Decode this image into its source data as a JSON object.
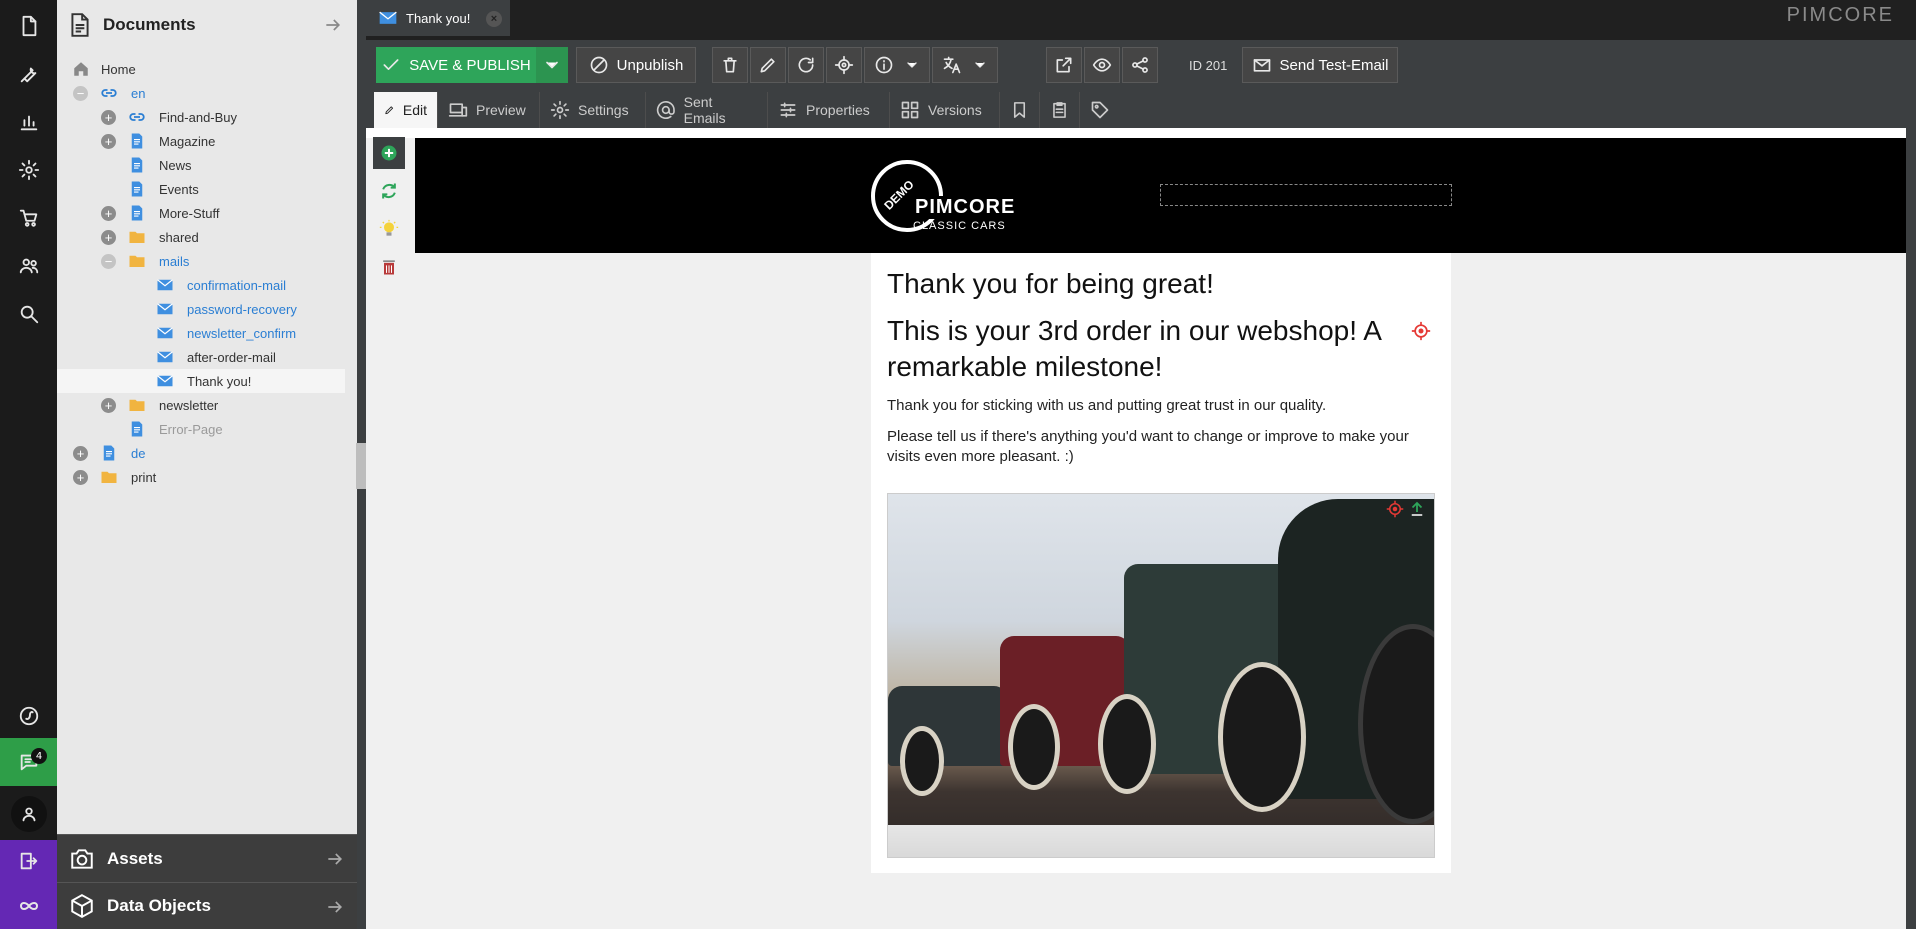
{
  "colors": {
    "accent_green": "#2ea55a",
    "rail_bg": "#1b1b1b",
    "purple": "#6428b4",
    "link_blue": "#2a7ed3"
  },
  "rail": {
    "items": [
      "documents-icon",
      "tools-icon",
      "reports-icon",
      "settings-icon",
      "ecommerce-icon",
      "users-icon",
      "search-icon"
    ],
    "bottom": [
      "symfony-icon",
      "notifications-icon",
      "user-avatar-icon",
      "logout-icon",
      "pimcore-infinity-icon"
    ],
    "notifications_count": "4"
  },
  "tree": {
    "title": "Documents",
    "nodes": [
      {
        "label": "Home"
      },
      {
        "label": "en"
      },
      {
        "label": "Find-and-Buy"
      },
      {
        "label": "Magazine"
      },
      {
        "label": "News"
      },
      {
        "label": "Events"
      },
      {
        "label": "More-Stuff"
      },
      {
        "label": "shared"
      },
      {
        "label": "mails"
      },
      {
        "label": "confirmation-mail"
      },
      {
        "label": "password-recovery"
      },
      {
        "label": "newsletter_confirm"
      },
      {
        "label": "after-order-mail"
      },
      {
        "label": "Thank you!"
      },
      {
        "label": "newsletter"
      },
      {
        "label": "Error-Page"
      },
      {
        "label": "de"
      },
      {
        "label": "print"
      }
    ]
  },
  "panels": {
    "assets": "Assets",
    "data_objects": "Data Objects"
  },
  "tab": {
    "title": "Thank you!"
  },
  "brand_logo": "PIMCORE",
  "toolbar": {
    "save_publish": "SAVE & PUBLISH",
    "unpublish": "Unpublish",
    "id_label": "ID 201",
    "send_test_email": "Send Test-Email"
  },
  "subtabs": {
    "edit": "Edit",
    "preview": "Preview",
    "settings": "Settings",
    "sent_emails": "Sent Emails",
    "properties": "Properties",
    "versions": "Versions"
  },
  "email": {
    "logo_badge": "DEMO",
    "logo_name": "PIMCORE",
    "logo_sub": "CLASSIC CARS",
    "heading": "Thank you for being great!",
    "subheading": "This is your 3rd order in our webshop! A remarkable milestone!",
    "para1": "Thank you for sticking with us and putting great trust in our quality.",
    "para2": "Please tell us if there's anything you'd want to change or improve to make your visits even more pleasant. :)"
  }
}
